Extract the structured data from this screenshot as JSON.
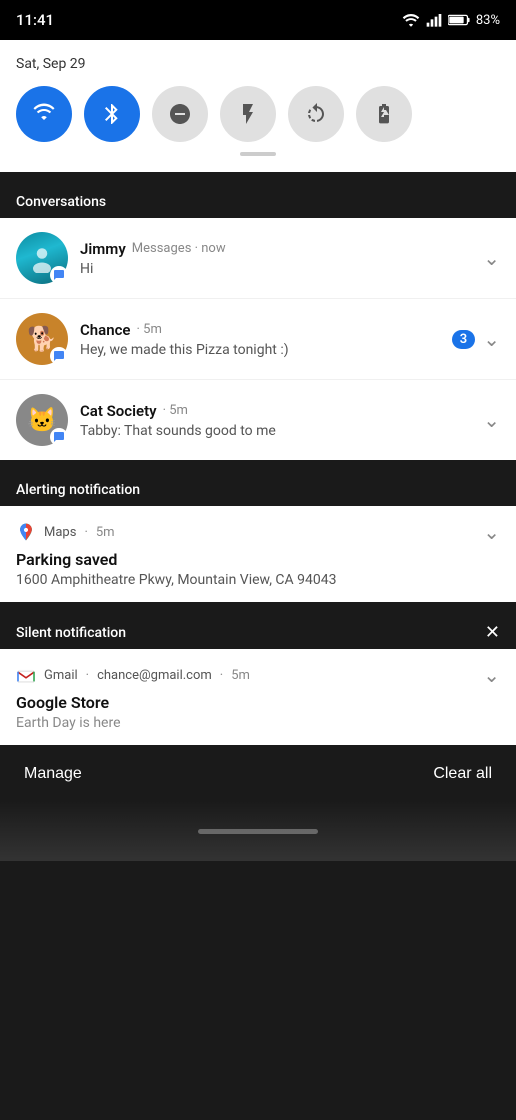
{
  "status_bar": {
    "time": "11:41",
    "battery": "83%"
  },
  "quick_settings": {
    "date": "Sat, Sep 29",
    "toggles": [
      {
        "id": "wifi",
        "label": "WiFi",
        "active": true
      },
      {
        "id": "bluetooth",
        "label": "Bluetooth",
        "active": true
      },
      {
        "id": "dnd",
        "label": "Do Not Disturb",
        "active": false
      },
      {
        "id": "flashlight",
        "label": "Flashlight",
        "active": false
      },
      {
        "id": "autorotate",
        "label": "Auto Rotate",
        "active": false
      },
      {
        "id": "battery_saver",
        "label": "Battery Saver",
        "active": false
      }
    ]
  },
  "sections": {
    "conversations": "Conversations",
    "alerting": "Alerting notification",
    "silent": "Silent notification"
  },
  "conversations": [
    {
      "name": "Jimmy",
      "meta": "Messages · now",
      "message": "Hi",
      "badge": null
    },
    {
      "name": "Chance",
      "meta": "5m",
      "message": "Hey, we made this Pizza tonight :)",
      "badge": "3"
    },
    {
      "name": "Cat Society",
      "meta": "5m",
      "message": "Tabby: That sounds good to me",
      "badge": null
    }
  ],
  "alerting_notification": {
    "app": "Maps",
    "time": "5m",
    "title": "Parking saved",
    "body": "1600 Amphitheatre Pkwy, Mountain View, CA 94043"
  },
  "silent_notification": {
    "app": "Gmail",
    "sender": "chance@gmail.com",
    "time": "5m",
    "title": "Google Store",
    "body": "Earth Day is here"
  },
  "bottom_bar": {
    "manage": "Manage",
    "clear_all": "Clear all"
  }
}
